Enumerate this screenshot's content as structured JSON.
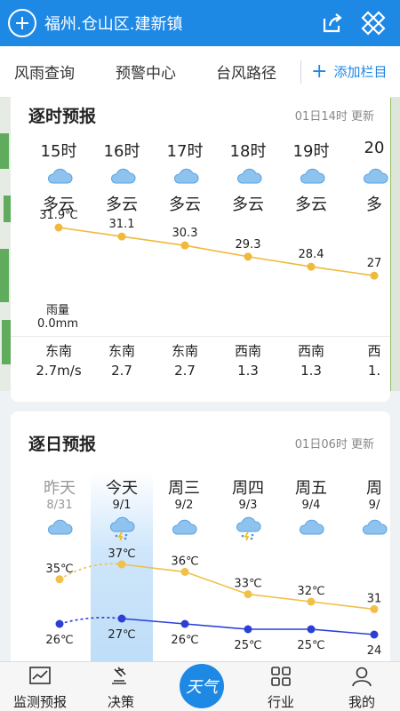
{
  "header": {
    "location": "福州.仓山区.建新镇",
    "color": "#1e88e5",
    "icons": [
      "add-city-icon",
      "share-icon",
      "more-icon"
    ]
  },
  "categories": {
    "items": [
      "风雨查询",
      "预警中心",
      "台风路径"
    ],
    "add_label": "添加栏目"
  },
  "hourly": {
    "title": "逐时预报",
    "update_time": "01日14时 更新",
    "hours": [
      {
        "time": "15时",
        "weather": "多云",
        "temp": "31.9℃",
        "dir": "东南",
        "speed": "2.7m/s"
      },
      {
        "time": "16时",
        "weather": "多云",
        "temp": "31.1",
        "dir": "东南",
        "speed": "2.7"
      },
      {
        "time": "17时",
        "weather": "多云",
        "temp": "30.3",
        "dir": "东南",
        "speed": "2.7"
      },
      {
        "time": "18时",
        "weather": "多云",
        "temp": "29.3",
        "dir": "西南",
        "speed": "1.3"
      },
      {
        "time": "19时",
        "weather": "多云",
        "temp": "28.4",
        "dir": "西南",
        "speed": "1.3"
      },
      {
        "time": "20",
        "weather": "多",
        "temp": "27",
        "dir": "西",
        "speed": "1."
      }
    ],
    "temp_values": [
      31.9,
      31.1,
      30.3,
      29.3,
      28.4,
      27.6
    ],
    "rain_label": "雨量",
    "rain_value": "0.0mm",
    "line_color": "#f0b93a"
  },
  "daily": {
    "title": "逐日预报",
    "update_time": "01日06时 更新",
    "days": [
      {
        "name": "昨天",
        "date": "8/31",
        "icon": "cloud-icon",
        "past": true
      },
      {
        "name": "今天",
        "date": "9/1",
        "icon": "thunder-rain-icon",
        "past": false
      },
      {
        "name": "周三",
        "date": "9/2",
        "icon": "cloud-icon",
        "past": false
      },
      {
        "name": "周四",
        "date": "9/3",
        "icon": "thunder-rain-icon",
        "past": false
      },
      {
        "name": "周五",
        "date": "9/4",
        "icon": "cloud-icon",
        "past": false
      },
      {
        "name": "周",
        "date": "9/",
        "icon": "cloud-icon",
        "past": false
      }
    ],
    "high_labels": [
      "35℃",
      "37℃",
      "36℃",
      "33℃",
      "32℃",
      "31"
    ],
    "high_values": [
      35,
      37,
      36,
      33,
      32,
      31
    ],
    "low_labels": [
      "26℃",
      "27℃",
      "26℃",
      "25℃",
      "25℃",
      "24"
    ],
    "low_values": [
      26,
      27,
      26,
      25,
      25,
      24
    ],
    "high_color": "#f0c04a",
    "low_color": "#2a3fd6"
  },
  "nav": {
    "items": [
      "监测预报",
      "决策",
      "天气",
      "行业",
      "我的"
    ],
    "active": "天气"
  }
}
